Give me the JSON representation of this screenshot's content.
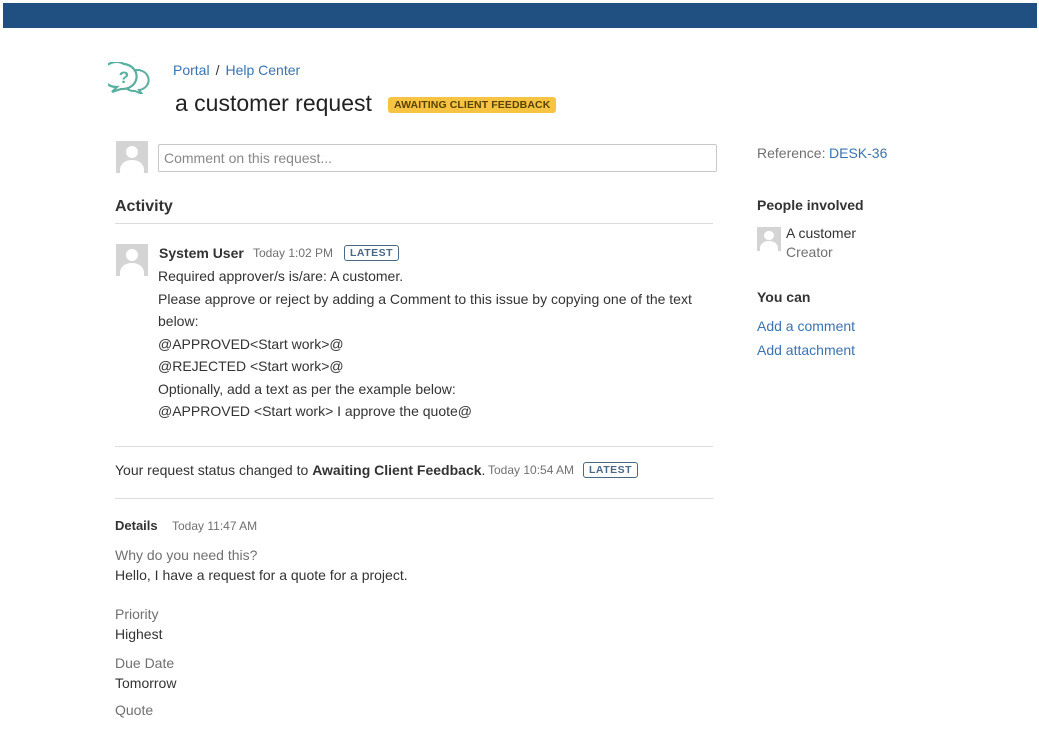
{
  "colors": {
    "topbar": "#205081",
    "link": "#3b73af",
    "status_lozenge_bg": "#f6c342",
    "latest_lozenge": "#4a6785"
  },
  "header": {
    "icon": "help-center-speech-bubble-icon",
    "breadcrumb": {
      "portal": "Portal",
      "separator": "/",
      "help_center": "Help Center"
    },
    "title": "a customer request",
    "status": "AWAITING CLIENT FEEDBACK"
  },
  "comment_box": {
    "placeholder": "Comment on this request..."
  },
  "activity": {
    "heading": "Activity",
    "comment": {
      "author": "System User",
      "time": "Today 1:02 PM",
      "badge": "LATEST",
      "lines": [
        "Required approver/s is/are: A customer.",
        "Please approve or reject by adding a Comment to this issue by copying one of the text below:",
        "@APPROVED<Start work>@",
        "@REJECTED <Start work>@",
        "Optionally, add a text as per the example below:",
        "@APPROVED <Start work> I approve the quote@"
      ]
    },
    "status_change": {
      "prefix": "Your request status changed to",
      "status": "Awaiting Client Feedback",
      "suffix": ".",
      "time": "Today 10:54 AM",
      "badge": "LATEST"
    }
  },
  "details": {
    "heading": "Details",
    "time": "Today 11:47 AM",
    "fields": [
      {
        "label": "Why do you need this?",
        "value": "Hello, I have a request for a quote for a project."
      },
      {
        "label": "Priority",
        "value": "Highest"
      },
      {
        "label": "Due Date",
        "value": "Tomorrow"
      },
      {
        "label": "Quote",
        "value": ""
      }
    ]
  },
  "sidebar": {
    "reference_label": "Reference:",
    "reference_value": "DESK-36",
    "people_heading": "People involved",
    "person": {
      "name": "A customer",
      "role": "Creator"
    },
    "you_can_heading": "You can",
    "actions": [
      "Add a comment",
      "Add attachment"
    ]
  }
}
